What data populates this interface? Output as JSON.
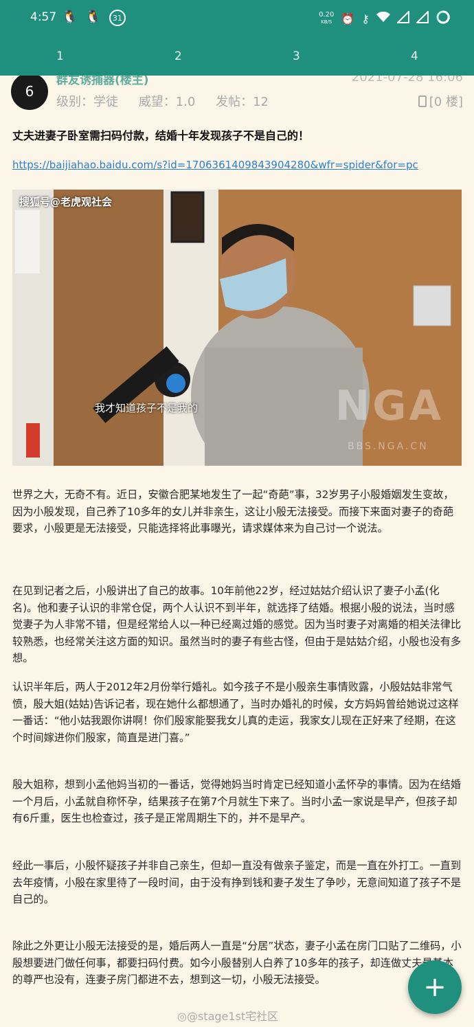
{
  "status": {
    "time": "4:57",
    "badge": "31",
    "net": "0.20",
    "net_unit": "KB/S"
  },
  "pages": [
    "1",
    "2",
    "3",
    "4"
  ],
  "post": {
    "author": "群友诱捕器(楼主)",
    "avatar_text": "6",
    "date": "2021-07-28 16:06",
    "level": "级别：学徒",
    "prestige": "威望：1.0",
    "posts": "发帖：12",
    "floor": "[0 楼]",
    "title": "丈夫进妻子卧室需扫码付款，结婚十年发现孩子不是自己的！",
    "link": "https://baijiahao.baidu.com/s?id=1706361409843904280&wfr=spider&for=pc",
    "image": {
      "source_label": "搜狐号@老虎观社会",
      "caption": "我才知道孩子不是我的",
      "watermark": "NGA",
      "watermark_url": "BBS.NGA.CN"
    },
    "paragraphs": [
      "世界之大，无奇不有。近日，安徽合肥某地发生了一起“奇葩”事，32岁男子小殷婚姻发生变故，因为小殷发现，自己养了10多年的女儿并非亲生，这让小殷无法接受。而接下来面对妻子的奇葩要求，小殷更是无法接受，只能选择将此事曝光，请求媒体来为自己讨一个说法。",
      "在见到记者之后，小殷讲出了自己的故事。10年前他22岁，经过姑姑介绍认识了妻子小孟(化名)。他和妻子认识的非常仓促，两个人认识不到半年，就选择了结婚。根据小殷的说法，当时感觉妻子为人非常不错，但是经常给人以一种已经离过婚的感觉。因为当时妻子对离婚的相关法律比较熟悉，也经常关注这方面的知识。虽然当时的妻子有些古怪，但由于是姑姑介绍，小殷也没有多想。",
      "认识半年后，两人于2012年2月份举行婚礼。如今孩子不是小殷亲生事情败露，小殷姑姑非常气愤，殷大姐(姑姑)告诉记者，现在她什么都想通了，当时办婚礼的时候，女方妈妈曾给她说过这样一番话：“他小姑我跟你讲啊！你们殷家能娶我女儿真的走运，我家女儿现在正好来了经期，在这个时间嫁进你们殷家，简直是进门喜。”",
      "殷大姐称，想到小孟他妈当初的一番话，觉得她妈当时肯定已经知道小孟怀孕的事情。因为在结婚一个月后，小孟就自称怀孕，结果孩子在第7个月就生下来了。当时小孟一家说是早产，但孩子却有6斤重，医生也检查过，孩子是正常周期生下的，并不是早产。",
      "经此一事后，小殷怀疑孩子并非自己亲生，但却一直没有做亲子鉴定，而是一直在外打工。一直到去年疫情，小殷在家里待了一段时间，由于没有挣到钱和妻子发生了争吵，无意间知道了孩子不是自己的。",
      "除此之外更让小殷无法接受的是，婚后两人一直是“分居”状态，妻子小孟在房门口贴了二维码，小殷想要进门做任何事，都要扫码付费。如今小殷替别人白养了10多年的孩子，却连做丈夫最基本的尊严也没有，连妻子房门都进不去，想到这一切，小殷无法接受。"
    ]
  },
  "fab_symbol": "+",
  "watermark": "@stage1st宅社区"
}
